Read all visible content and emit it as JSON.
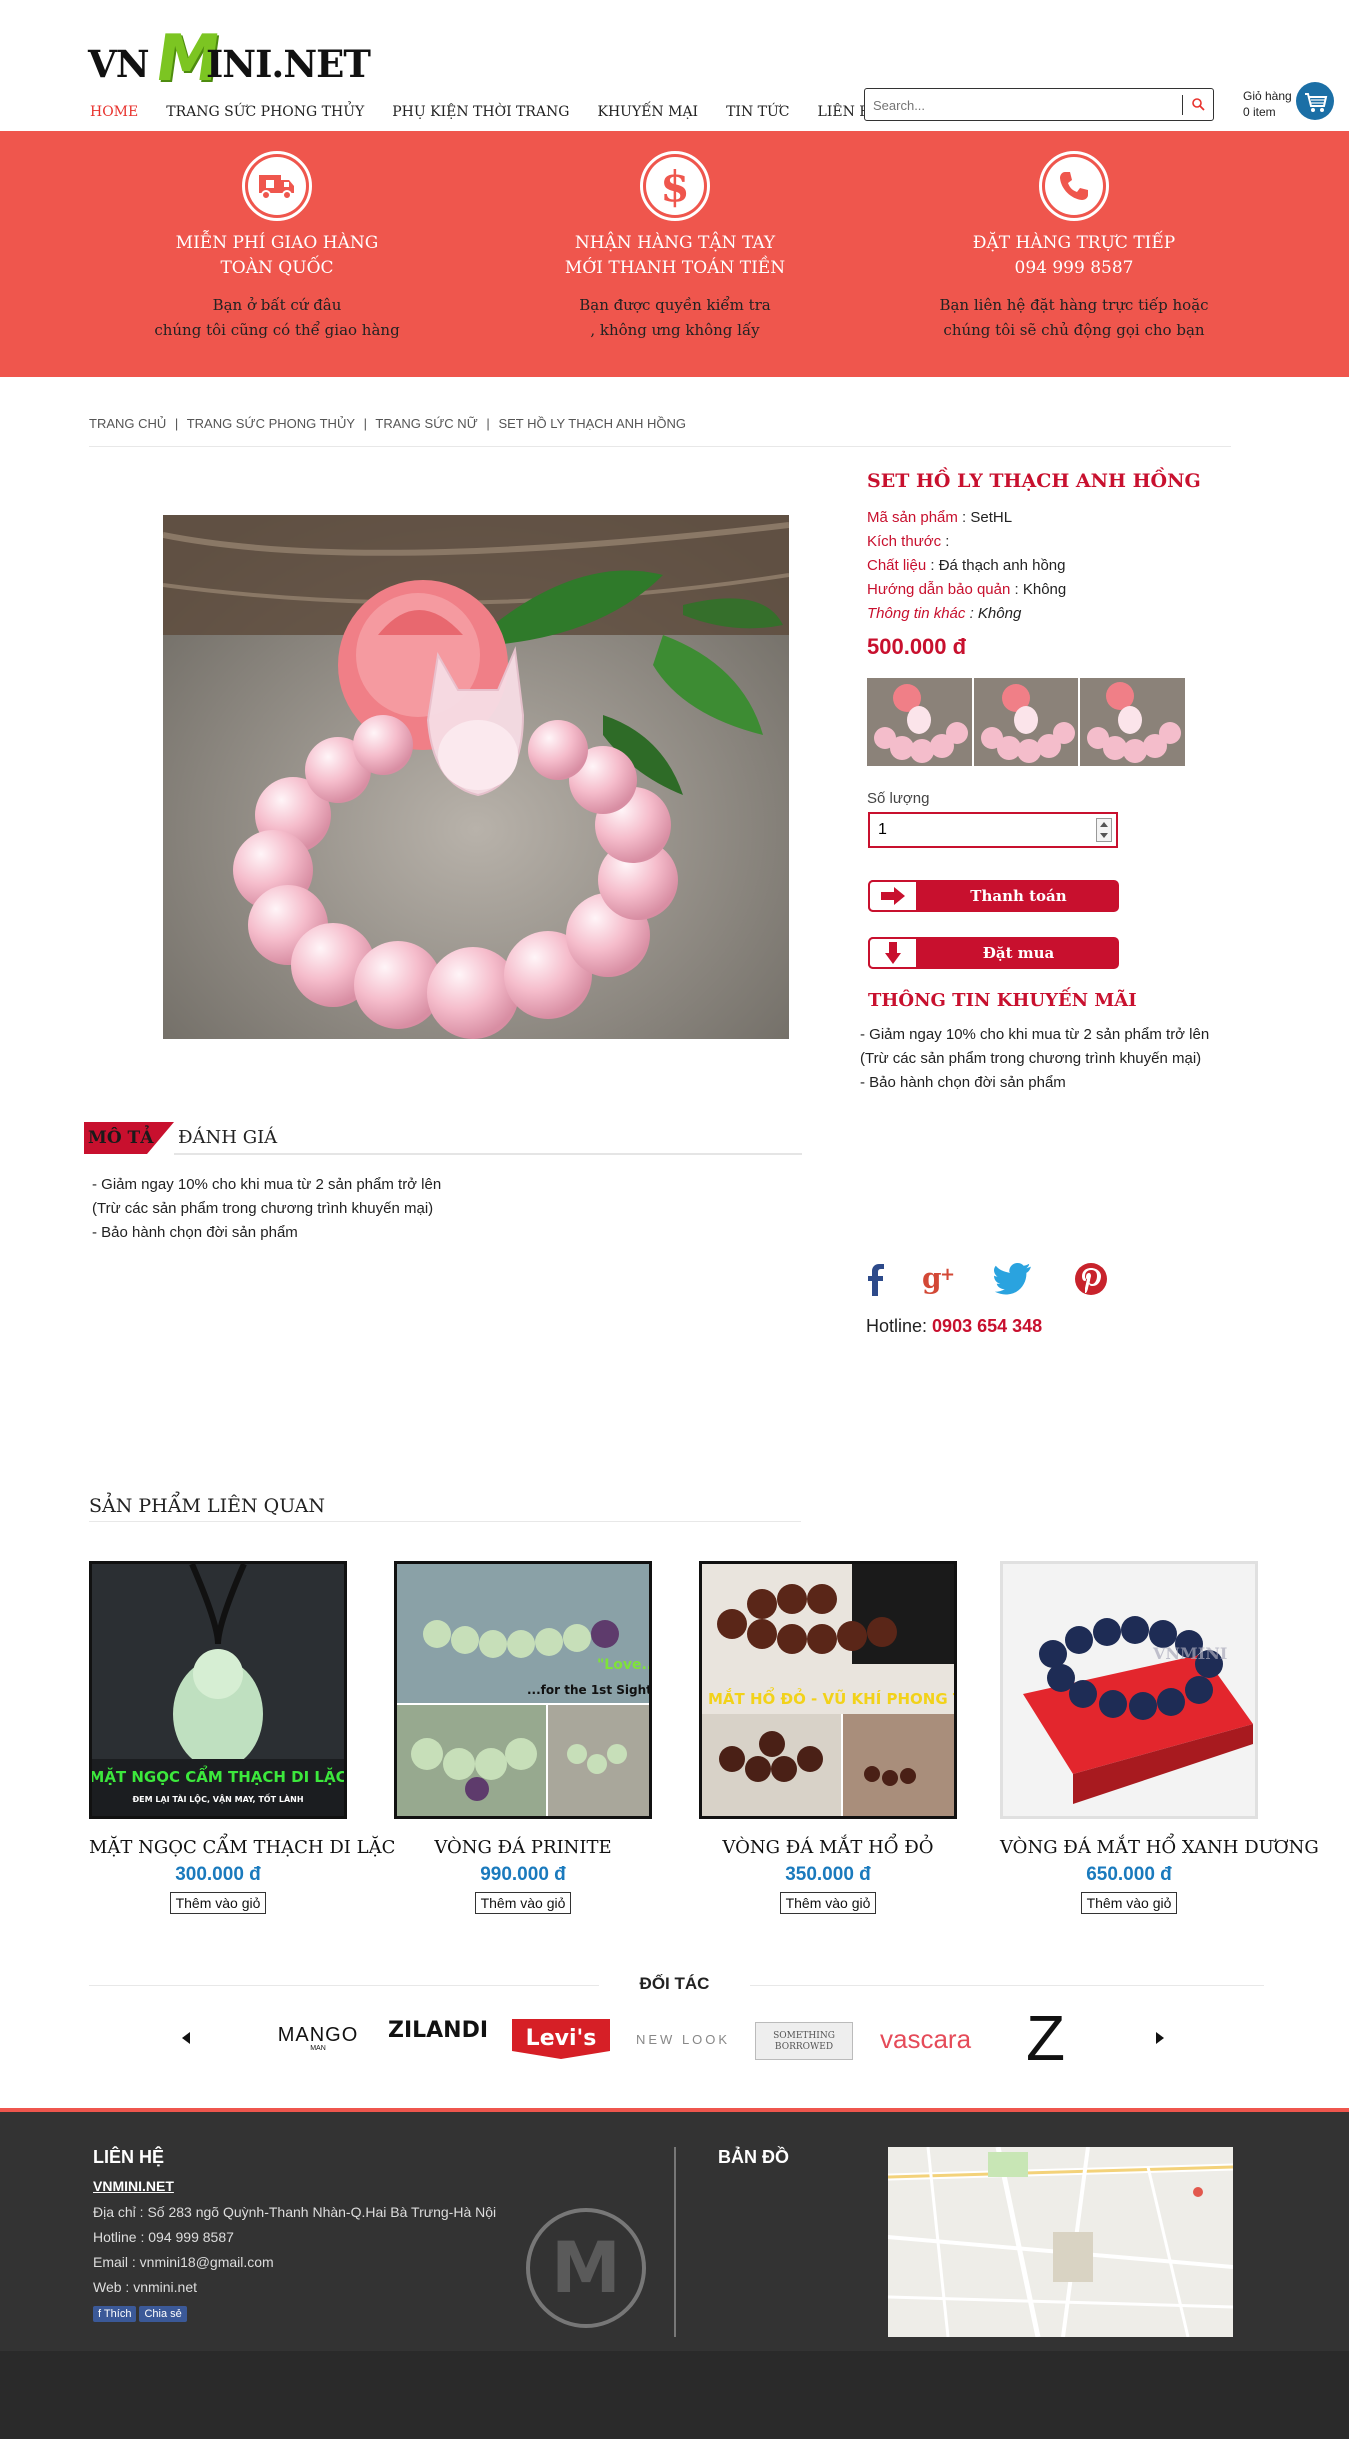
{
  "header": {
    "logo": {
      "part1": "VN",
      "part2": "M",
      "part3": "INI.NET"
    },
    "nav": [
      "HOME",
      "TRANG SỨC PHONG THỦY",
      "PHỤ KIỆN THỜI TRANG",
      "KHUYẾN MẠI",
      "TIN TỨC",
      "LIÊN HỆ"
    ],
    "search_placeholder": "Search...",
    "cart": {
      "label": "Giỏ hàng",
      "count": "0 item"
    }
  },
  "banner": {
    "features": [
      {
        "icon": "delivery-truck-icon",
        "title1": "MIỄN PHÍ GIAO HÀNG",
        "title2": "TOÀN QUỐC",
        "desc1": "Bạn ở bất cứ đâu",
        "desc2": "chúng tôi cũng có thể giao hàng"
      },
      {
        "icon": "dollar-icon",
        "title1": "NHẬN HÀNG TẬN TAY",
        "title2": "MỚI THANH TOÁN TIỀN",
        "desc1": "Bạn được quyền kiểm tra",
        "desc2": ", không ưng không lấy"
      },
      {
        "icon": "phone-icon",
        "title1": "ĐẶT HÀNG TRỰC TIẾP",
        "title2": "094 999 8587",
        "desc1": "Bạn liên hệ đặt hàng trực tiếp hoặc",
        "desc2": "chúng tôi sẽ chủ động gọi cho bạn"
      }
    ]
  },
  "breadcrumb": [
    "TRANG CHỦ",
    "|",
    "TRANG SỨC PHONG THỦY",
    "|",
    "TRANG SỨC NỮ",
    "|",
    "SET HỒ LY THẠCH ANH HỒNG"
  ],
  "product": {
    "title": "SET HỒ LY THẠCH ANH HỒNG",
    "code_label": "Mã sản phẩm",
    "code": "SetHL",
    "size_label": "Kích thước",
    "size": "",
    "material_label": "Chất liệu",
    "material": "Đá thạch anh hồng",
    "care_label": "Hướng dẫn bảo quản",
    "care": "Không",
    "other_label": "Thông tin khác",
    "other": "Không",
    "price": "500.000 đ",
    "qty_label": "Số lượng",
    "qty_value": "1",
    "buy_label": "Thanh toán",
    "order_label": "Đặt mua"
  },
  "promo": {
    "title": "THÔNG TIN KHUYẾN MÃI",
    "lines": [
      "- Giảm ngay 10% cho khi mua từ 2 sản phẩm trở lên",
      "(Trừ các sản phẩm trong chương trình khuyến mại)",
      "- Bảo hành chọn đời sản phẩm"
    ]
  },
  "tabs": {
    "active": "MÔ TẢ",
    "other": "ĐÁNH GIÁ"
  },
  "description": [
    "- Giảm ngay 10% cho khi mua từ 2 sản phẩm trở lên",
    "(Trừ các sản phẩm trong chương trình khuyến mại)",
    "- Bảo hành chọn đời sản phẩm"
  ],
  "social": {
    "hotline_label": "Hotline:",
    "hotline": "0903 654 348"
  },
  "related": {
    "title": "SẢN PHẨM LIÊN QUAN",
    "items": [
      {
        "name": "MẶT NGỌC CẨM THẠCH DI LẶC",
        "price": "300.000 đ",
        "add": "Thêm vào giỏ",
        "caption1": "MẶT NGỌC CẨM THẠCH DI LẶC",
        "caption2": "ĐEM LẠI TÀI LỘC, VẬN MAY, TỐT LÀNH"
      },
      {
        "name": "VÒNG ĐÁ PRINITE",
        "price": "990.000 đ",
        "add": "Thêm vào giỏ",
        "caption1": "\"Love...",
        "caption2": "...for the 1st Sight\""
      },
      {
        "name": "VÒNG ĐÁ MẮT HỔ ĐỎ",
        "price": "350.000 đ",
        "add": "Thêm vào giỏ",
        "caption1": "MẮT HỔ ĐỎ - VŨ KHÍ PHONG THỦY",
        "caption2": ""
      },
      {
        "name": "VÒNG ĐÁ MẮT HỔ XANH DƯƠNG",
        "price": "650.000 đ",
        "add": "Thêm vào giỏ",
        "caption1": "VNMINI",
        "caption2": ""
      }
    ]
  },
  "partners": {
    "title": "ĐỐI TÁC",
    "logos": [
      "MANGO",
      "MAN",
      "ZILANDI",
      "Levi's",
      "NEW LOOK",
      "SOMETHING BORROWED",
      "vascara",
      "Z"
    ]
  },
  "footer": {
    "contact_title": "LIÊN HỆ",
    "brand": "VNMINI.NET",
    "address": "Địa chỉ : Số 283 ngõ Quỳnh-Thanh Nhàn-Q.Hai Bà Trưng-Hà Nội",
    "hotline": "Hotline : 094 999 8587",
    "email": "Email : vnmini18@gmail.com",
    "web": "Web : vnmini.net",
    "like": "Thích",
    "share": "Chia sẻ",
    "map_title": "BẢN ĐỒ"
  },
  "colors": {
    "brand_red": "#c8102e",
    "banner_red": "#ef564d",
    "price_blue": "#1a7abd",
    "logo_green": "#7cc522",
    "footer_bg": "#333333"
  }
}
